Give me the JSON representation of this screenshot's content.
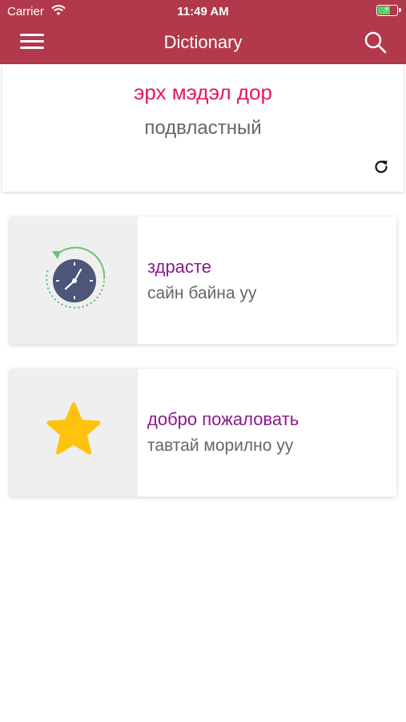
{
  "status_bar": {
    "carrier": "Carrier",
    "time": "11:49 AM"
  },
  "nav": {
    "title": "Dictionary"
  },
  "word_of_day": {
    "mongolian": "эрх мэдэл дор",
    "russian": "подвластный"
  },
  "history_tile": {
    "title": "здрасте",
    "subtitle": "сайн байна уу",
    "icon": "history-clock-icon"
  },
  "favorites_tile": {
    "title": "добро пожаловать",
    "subtitle": "тавтай морилно уу",
    "icon": "star-icon"
  },
  "colors": {
    "header": "#b2394b",
    "accent_pink": "#e8175d",
    "accent_purple": "#8b1a8b",
    "star": "#ffc20e",
    "clock": "#4b5678",
    "clock_ring": "#6cc07a"
  }
}
